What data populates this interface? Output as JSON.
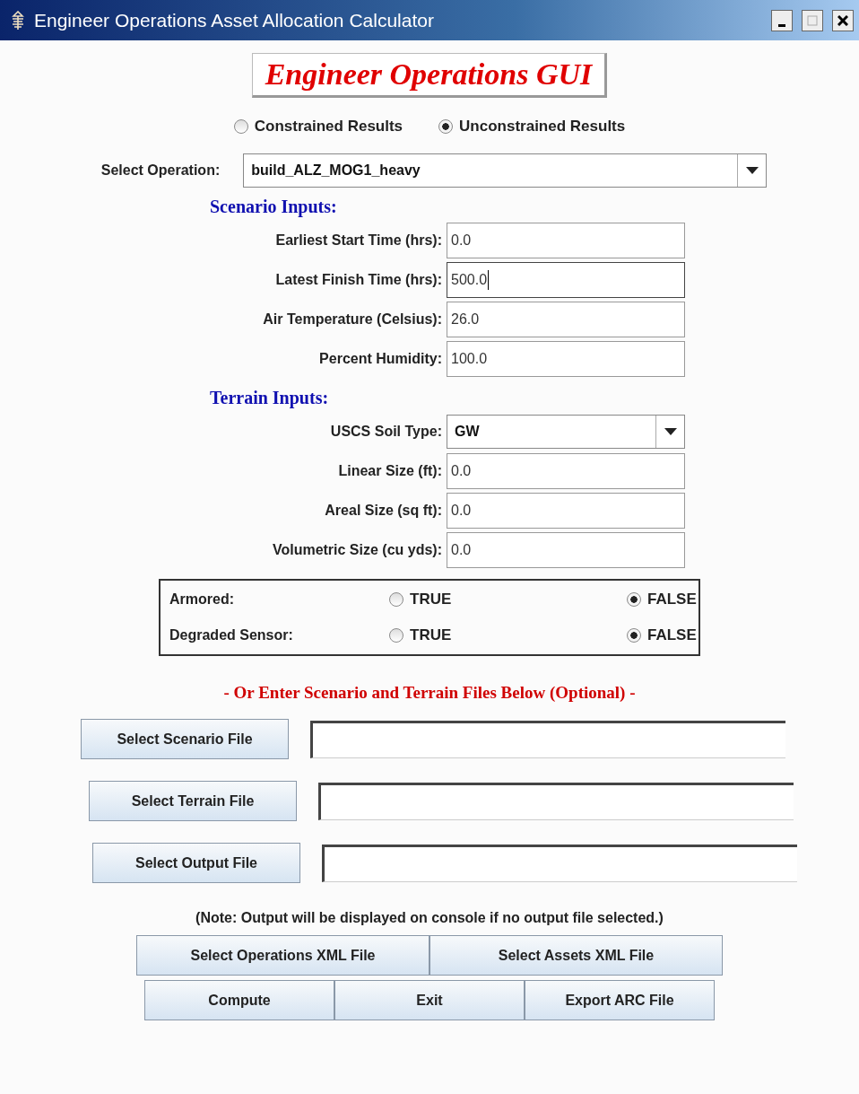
{
  "window": {
    "title": "Engineer Operations Asset Allocation Calculator"
  },
  "header": {
    "title": "Engineer Operations GUI"
  },
  "results_mode": [
    {
      "label": "Constrained Results",
      "selected": false
    },
    {
      "label": "Unconstrained Results",
      "selected": true
    }
  ],
  "operation": {
    "label": "Select Operation:",
    "value": "build_ALZ_MOG1_heavy"
  },
  "scenario_inputs": {
    "heading": "Scenario Inputs:",
    "fields": [
      {
        "kind": "text",
        "label": "Earliest Start Time (hrs):",
        "value": "0.0",
        "focused": false
      },
      {
        "kind": "text",
        "label": "Latest Finish Time (hrs):",
        "value": "500.0",
        "focused": true
      },
      {
        "kind": "text",
        "label": "Air Temperature (Celsius):",
        "value": "26.0",
        "focused": false
      },
      {
        "kind": "text",
        "label": "Percent Humidity:",
        "value": "100.0",
        "focused": false
      }
    ]
  },
  "terrain_inputs": {
    "heading": "Terrain Inputs:",
    "fields": [
      {
        "kind": "combo",
        "label": "USCS Soil Type:",
        "value": "GW"
      },
      {
        "kind": "text",
        "label": "Linear Size (ft):",
        "value": "0.0",
        "focused": false
      },
      {
        "kind": "text",
        "label": "Areal Size (sq ft):",
        "value": "0.0",
        "focused": false
      },
      {
        "kind": "text",
        "label": "Volumetric Size (cu yds):",
        "value": "0.0",
        "focused": false
      }
    ]
  },
  "flags": [
    {
      "label": "Armored:",
      "options": [
        {
          "label": "TRUE",
          "selected": false
        },
        {
          "label": "FALSE",
          "selected": true
        }
      ]
    },
    {
      "label": "Degraded Sensor:",
      "options": [
        {
          "label": "TRUE",
          "selected": false
        },
        {
          "label": "FALSE",
          "selected": true
        }
      ]
    }
  ],
  "files_heading": "- Or Enter Scenario and Terrain Files Below (Optional) -",
  "file_rows": [
    {
      "button": "Select Scenario File"
    },
    {
      "button": "Select Terrain File"
    },
    {
      "button": "Select Output File"
    }
  ],
  "note": "(Note: Output will be displayed on console if no output file selected.)",
  "xml_buttons": [
    "Select Operations XML File",
    "Select Assets XML File"
  ],
  "action_buttons": [
    "Compute",
    "Exit",
    "Export ARC File"
  ]
}
